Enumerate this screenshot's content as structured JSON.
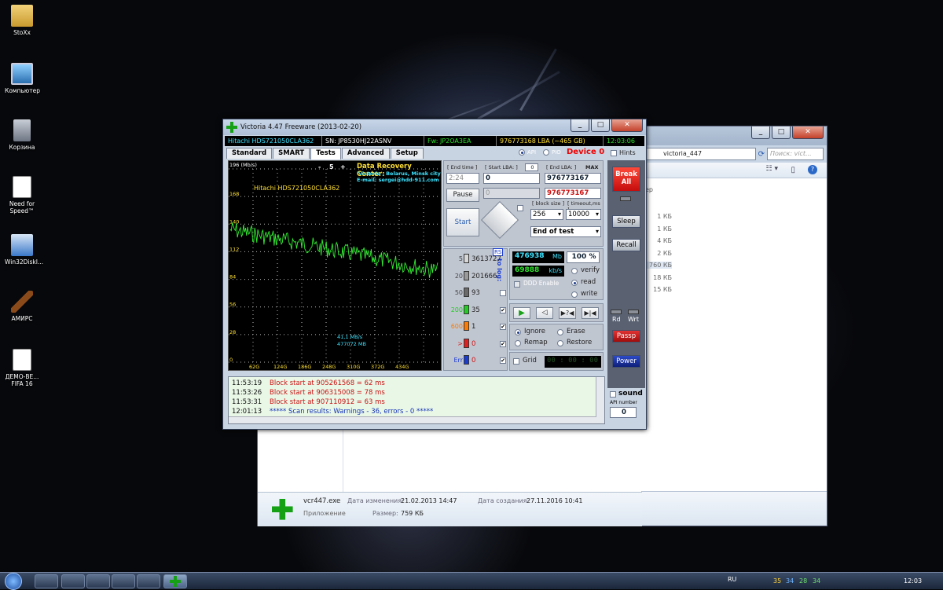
{
  "desktop": {
    "icons": [
      {
        "name": "folder-icon",
        "label": "StoXx"
      },
      {
        "name": "computer-icon",
        "label": "Компьютер"
      },
      {
        "name": "recycle-bin-icon",
        "label": "Корзина"
      },
      {
        "name": "shortcut-icon",
        "label": "Need for Speed™"
      },
      {
        "name": "installer-icon",
        "label": "Win32DiskI..."
      },
      {
        "name": "gavel-icon",
        "label": "АМИРС"
      },
      {
        "name": "shortcut-icon",
        "label": "ДЕМО-ВЕ... FIFA 16"
      }
    ]
  },
  "explorer": {
    "address": "victoria_447",
    "search_placeholder": "Поиск: vict...",
    "column_hint": "ер",
    "sizes": [
      "1 КБ",
      "1 КБ",
      "4 КБ",
      "2 КБ",
      "760 КБ",
      "18 КБ",
      "15 КБ"
    ],
    "details": {
      "filename": "vcr447.exe",
      "type": "Приложение",
      "modified_label": "Дата изменения:",
      "modified": "21.02.2013 14:47",
      "created_label": "Дата создания:",
      "created": "27.11.2016 10:41",
      "size_label": "Размер:",
      "size": "759 КБ"
    }
  },
  "victoria": {
    "title": "Victoria 4.47  Freeware (2013-02-20)",
    "info": {
      "model": "Hitachi HDS721050CLA362",
      "serial": "SN: JP8530HJ22ASNV",
      "firmware": "Fw: JP2OA3EA",
      "lba": "976773168 LBA (~465 GB)",
      "time": "12:03:06"
    },
    "tabs": [
      "Standard",
      "SMART",
      "Tests",
      "Advanced",
      "Setup"
    ],
    "api_label": "API",
    "pio_label": "PIO",
    "device_label": "Device 0",
    "hints_label": "Hints",
    "graph": {
      "y_unit": "196 (Mb/s)",
      "y_ticks": [
        "168",
        "140",
        "112",
        "84",
        "56",
        "28",
        "0"
      ],
      "x_ticks": [
        "62G",
        "124G",
        "186G",
        "248G",
        "310G",
        "372G",
        "434G"
      ],
      "scale_minus": "-",
      "scale_value": "5",
      "scale_plus": "+",
      "drive_label": "Hitachi HDS721050CLA362",
      "drc_title": "Data Recovery Center:",
      "drc_line1": "'Victoria', Belarus, Minsk city",
      "drc_line2": "E-mail: sergei@hdd-911.com",
      "speed": "41,1 MB/s",
      "position": "477072 MB"
    },
    "controls": {
      "end_time_label": "[ End time ]",
      "end_time": "2:24",
      "start_lba_label": "[ Start LBA: ]",
      "start_lba_small": "0",
      "start_lba": "0",
      "end_lba_label": "[ End LBA: ]",
      "max_label": "MAX",
      "end_lba": "976773167",
      "end_lba2": "976773167",
      "second_field": "0",
      "pause": "Pause",
      "start": "Start",
      "block_size_label": "[ block size ]",
      "block_size": "256",
      "timeout_label": "[ timeout,ms ]",
      "timeout": "10000",
      "end_action": "End of test"
    },
    "stats": {
      "rs": "RS",
      "to_log": "to log:",
      "rows": [
        {
          "label": "5",
          "count": "3613727",
          "color": "#d8d8d8"
        },
        {
          "label": "20",
          "count": "201666",
          "color": "#9a9a9a"
        },
        {
          "label": "50",
          "count": "93",
          "color": "#6a6a6a"
        },
        {
          "label": "200",
          "count": "35",
          "color": "#22cc22"
        },
        {
          "label": "600",
          "count": "1",
          "color": "#ff7a00"
        },
        {
          "label": ">",
          "count": "0",
          "color": "#e02020"
        },
        {
          "label": "Err",
          "count": "0",
          "color": "#1a3bd0"
        }
      ]
    },
    "progress": {
      "mb": "476938",
      "mb_unit": "Mb",
      "percent": "100",
      "percent_unit": "%",
      "speed": "69888",
      "speed_unit": "kb/s",
      "ddd": "DDD Enable",
      "verify": "verify",
      "read": "read",
      "write": "write"
    },
    "actions": {
      "ignore": "Ignore",
      "erase": "Erase",
      "remap": "Remap",
      "restore": "Restore",
      "grid": "Grid",
      "timer": "00 : 00 : 00"
    },
    "right_buttons": {
      "break_all": "Break All",
      "sleep": "Sleep",
      "recall": "Recall",
      "rd": "Rd",
      "wrt": "Wrt",
      "passp": "Passp",
      "power": "Power",
      "sound": "sound",
      "api_number_label": "API number",
      "api_number": "0"
    },
    "log": [
      {
        "time": "11:53:19",
        "text": "Block start at 905261568 = 62 ms",
        "color": "#c11"
      },
      {
        "time": "11:53:26",
        "text": "Block start at 906315008 = 78 ms",
        "color": "#c11"
      },
      {
        "time": "11:53:31",
        "text": "Block start at 907110912 = 63 ms",
        "color": "#c11"
      },
      {
        "time": "12:01:13",
        "text": "***** Scan results: Warnings - 36, errors - 0 *****",
        "color": "#1533b8"
      }
    ]
  },
  "taskbar": {
    "lang": "RU",
    "tray_numbers": [
      "35",
      "34",
      "28",
      "34"
    ],
    "clock": "12:03"
  }
}
